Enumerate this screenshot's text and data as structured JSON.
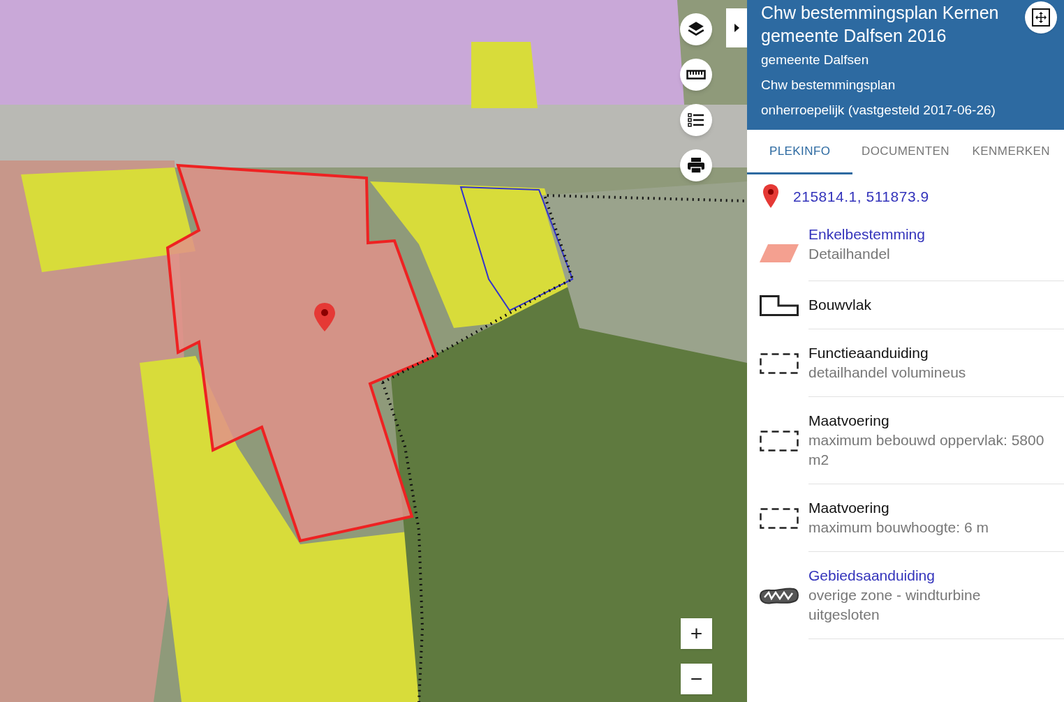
{
  "map": {
    "zoom_in": "+",
    "zoom_out": "−"
  },
  "panel": {
    "title": "Chw bestemmingsplan Kernen gemeente Dalfsen 2016",
    "details": [
      "gemeente Dalfsen",
      "Chw bestemmingsplan",
      "onherroepelijk (vastgesteld 2017-06-26)"
    ],
    "tabs": [
      {
        "label": "PLEKINFO",
        "selected": true
      },
      {
        "label": "DOCUMENTEN",
        "selected": false
      },
      {
        "label": "KENMERKEN",
        "selected": false
      }
    ],
    "coordinates": "215814.1, 511873.9",
    "legend": [
      {
        "kind": "fill",
        "title": "Enkelbestemming",
        "link": true,
        "subtitle": "Detailhandel",
        "color": "#f4a090"
      },
      {
        "kind": "outline",
        "title": "Bouwvlak",
        "link": false
      },
      {
        "kind": "dashed",
        "title": "Functieaanduiding",
        "link": false,
        "subtitle": "detailhandel volumineus"
      },
      {
        "kind": "dashed",
        "title": "Maatvoering",
        "link": false,
        "subtitle": "maximum bebouwd oppervlak: 5800 m2"
      },
      {
        "kind": "dashed",
        "title": "Maatvoering",
        "link": false,
        "subtitle": "maximum bouwhoogte: 6 m"
      },
      {
        "kind": "hatch",
        "title": "Gebiedsaanduiding",
        "link": true,
        "subtitle": "overige zone - windturbine uitgesloten"
      }
    ]
  }
}
